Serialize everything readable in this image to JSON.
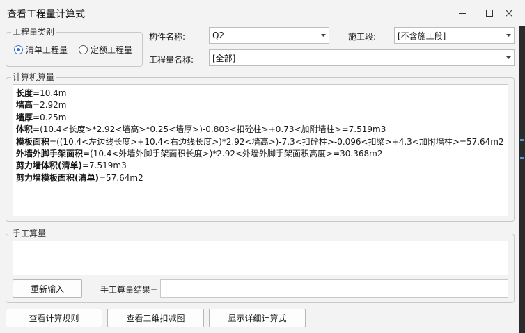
{
  "window": {
    "title": "查看工程量计算式"
  },
  "quantity_type": {
    "legend": "工程量类别",
    "options": [
      {
        "label": "清单工程量",
        "checked": true
      },
      {
        "label": "定额工程量",
        "checked": false
      }
    ]
  },
  "filters": {
    "component_label": "构件名称:",
    "component_value": "Q2",
    "section_label": "施工段:",
    "section_value": "[不含施工段]",
    "quantity_name_label": "工程量名称:",
    "quantity_name_value": "[全部]"
  },
  "computer_calc": {
    "legend": "计算机算量",
    "lines": [
      {
        "name": "长度",
        "expr": "=10.4m"
      },
      {
        "name": "墙高",
        "expr": "=2.92m"
      },
      {
        "name": "墙厚",
        "expr": "=0.25m"
      },
      {
        "name": "体积",
        "expr": "=(10.4<长度>*2.92<墙高>*0.25<墙厚>)-0.803<扣砼柱>+0.73<加附墙柱>=7.519m3"
      },
      {
        "name": "模板面积",
        "expr": "=((10.4<左边线长度>+10.4<右边线长度>)*2.92<墙高>)-7.3<扣砼柱>-0.096<扣梁>+4.3<加附墙柱>=57.64m2"
      },
      {
        "name": "外墙外脚手架面积",
        "expr": "=(10.4<外墙外脚手架面积长度>)*2.92<外墙外脚手架面积高度>=30.368m2"
      },
      {
        "name": "剪力墙体积(清单)",
        "expr": "=7.519m3"
      },
      {
        "name": "剪力墙模板面积(清单)",
        "expr": "=57.64m2"
      }
    ]
  },
  "manual_calc": {
    "legend": "手工算量",
    "reenter_label": "重新输入",
    "result_label": "手工算量结果=",
    "expression_value": "",
    "result_value": ""
  },
  "footer": {
    "view_rules_label": "查看计算规则",
    "view_3d_label": "查看三维扣减图",
    "show_detail_label": "显示详细计算式"
  },
  "colors": {
    "accent": "#3b6fd4",
    "chrome": "#f3f3f3"
  }
}
